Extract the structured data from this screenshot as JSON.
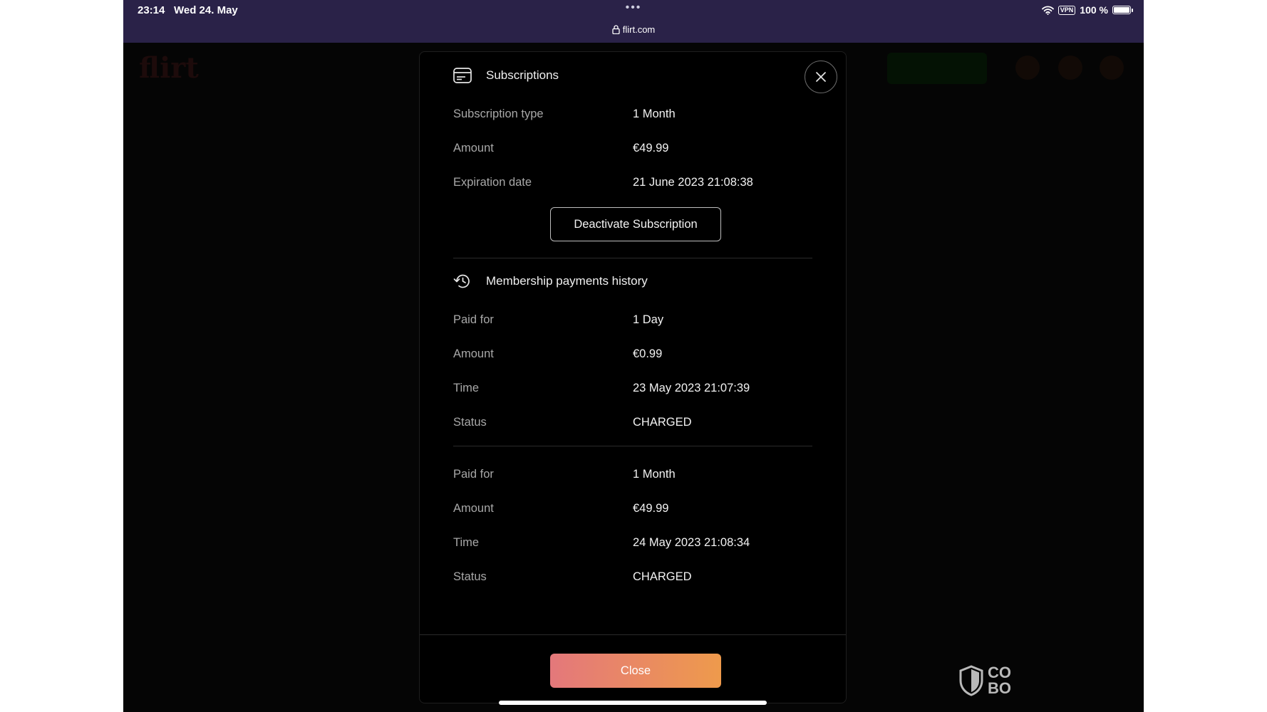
{
  "status_bar": {
    "time": "23:14",
    "date": "Wed 24. May",
    "url": "flirt.com",
    "vpn": "VPN",
    "battery": "100 %",
    "battery_level": 1.0,
    "more_dots": "•••"
  },
  "modal": {
    "subscriptions": {
      "title": "Subscriptions",
      "icon": "card-icon",
      "rows": [
        {
          "label": "Subscription type",
          "value": "1 Month"
        },
        {
          "label": "Amount",
          "value": "€49.99"
        },
        {
          "label": "Expiration date",
          "value": "21 June 2023 21:08:38"
        }
      ],
      "deactivate_label": "Deactivate Subscription"
    },
    "history": {
      "title": "Membership payments history",
      "icon": "history-icon",
      "payments": [
        {
          "rows": [
            {
              "label": "Paid for",
              "value": "1 Day"
            },
            {
              "label": "Amount",
              "value": "€0.99"
            },
            {
              "label": "Time",
              "value": "23 May 2023 21:07:39"
            },
            {
              "label": "Status",
              "value": "CHARGED"
            }
          ]
        },
        {
          "rows": [
            {
              "label": "Paid for",
              "value": "1 Month"
            },
            {
              "label": "Amount",
              "value": "€49.99"
            },
            {
              "label": "Time",
              "value": "24 May 2023 21:08:34"
            },
            {
              "label": "Status",
              "value": "CHARGED"
            }
          ]
        }
      ]
    },
    "close_label": "Close"
  },
  "colors": {
    "status_bar_bg": "#2a2248",
    "close_gradient_start": "#e4787b",
    "close_gradient_end": "#ee9a4c"
  },
  "watermark": {
    "line1": "CO",
    "line2": "BO"
  }
}
